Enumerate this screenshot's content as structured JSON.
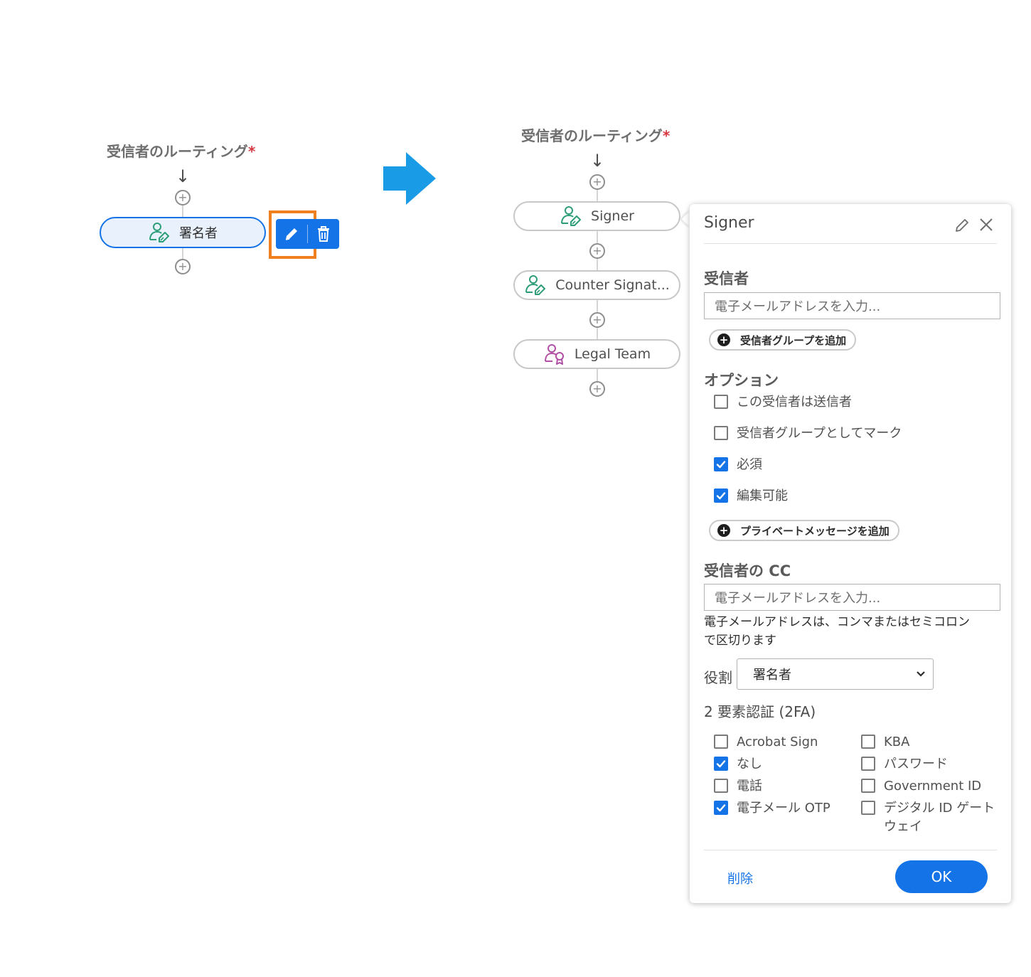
{
  "left": {
    "title": "受信者のルーティング",
    "required_mark": "*",
    "down_arrow": "↓",
    "plus": "+",
    "recipient_label": "署名者",
    "highlight_color": "#f07f20"
  },
  "right": {
    "title": "受信者のルーティング",
    "required_mark": "*",
    "down_arrow": "↓",
    "plus": "+",
    "recipients": [
      {
        "label": "Signer",
        "icon": "signer-icon"
      },
      {
        "label": "Counter Signat...",
        "icon": "signer-icon"
      },
      {
        "label": "Legal Team",
        "icon": "group-icon"
      }
    ]
  },
  "panel": {
    "title": "Signer",
    "recipient_section": "受信者",
    "email_placeholder": "電子メールアドレスを入力...",
    "add_group_label": "受信者グループを追加",
    "options_section": "オプション",
    "options": [
      {
        "label": "この受信者は送信者",
        "checked": false
      },
      {
        "label": "受信者グループとしてマーク",
        "checked": false
      },
      {
        "label": "必須",
        "checked": true
      },
      {
        "label": "編集可能",
        "checked": true
      }
    ],
    "add_private_message_label": "プライベートメッセージを追加",
    "cc_section": "受信者の CC",
    "cc_placeholder": "電子メールアドレスを入力...",
    "cc_help_line1": "電子メールアドレスは、コンマまたはセミコロン",
    "cc_help_line2": "で区切ります",
    "role_label": "役割",
    "role_value": "署名者",
    "tfa_section": "2 要素認証 (2FA)",
    "tfa_left": [
      {
        "label": "Acrobat Sign",
        "checked": false
      },
      {
        "label": "なし",
        "checked": true
      },
      {
        "label": "電話",
        "checked": false
      },
      {
        "label": "電子メール OTP",
        "checked": true
      }
    ],
    "tfa_right": [
      {
        "label": "KBA",
        "checked": false
      },
      {
        "label": "パスワード",
        "checked": false
      },
      {
        "label": "Government ID",
        "checked": false
      },
      {
        "label": "デジタル ID ゲート",
        "label2": "ウェイ",
        "checked": false
      }
    ],
    "delete_label": "削除",
    "ok_label": "OK"
  },
  "colors": {
    "accent": "#1473e6",
    "arrow": "#1a9be6",
    "signer_icon": "#2d9d78",
    "group_icon": "#b04fa4"
  }
}
